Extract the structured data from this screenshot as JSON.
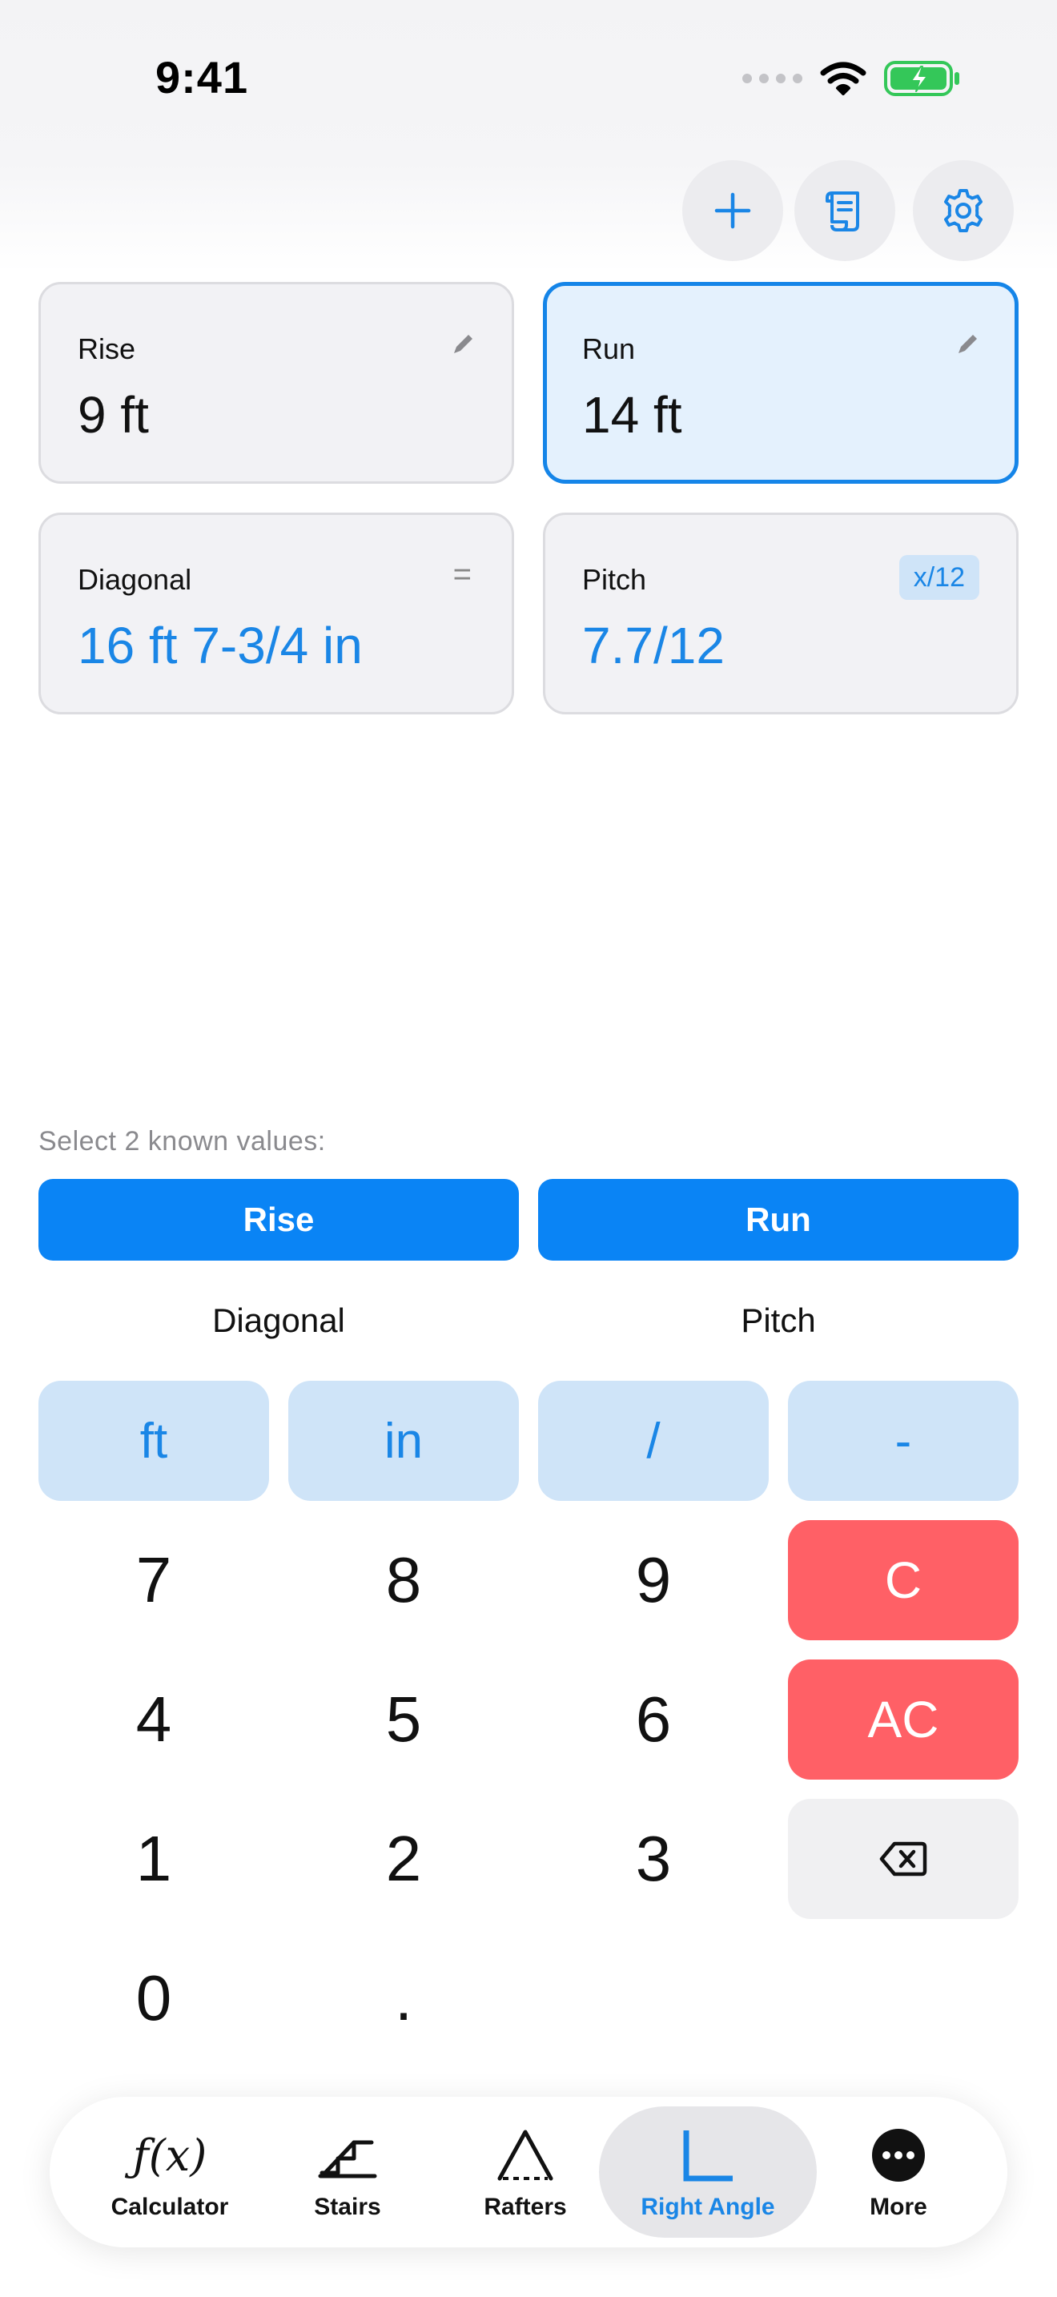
{
  "status_bar": {
    "time": "9:41"
  },
  "cards": {
    "rise": {
      "label": "Rise",
      "value": "9 ft"
    },
    "run": {
      "label": "Run",
      "value": "14 ft"
    },
    "diagonal": {
      "label": "Diagonal",
      "value": "16 ft 7-3/4 in",
      "indicator": "="
    },
    "pitch": {
      "label": "Pitch",
      "value": "7.7/12",
      "badge": "x/12"
    }
  },
  "selector": {
    "hint": "Select 2 known values:",
    "options": [
      {
        "label": "Rise",
        "selected": true
      },
      {
        "label": "Run",
        "selected": true
      },
      {
        "label": "Diagonal",
        "selected": false
      },
      {
        "label": "Pitch",
        "selected": false
      }
    ]
  },
  "keypad": {
    "units": [
      "ft",
      "in",
      "/",
      "-"
    ],
    "digits": [
      "7",
      "8",
      "9",
      "4",
      "5",
      "6",
      "1",
      "2",
      "3",
      "0",
      "."
    ],
    "clear": "C",
    "all_clear": "AC"
  },
  "tabbar": {
    "items": [
      {
        "label": "Calculator",
        "icon": "function-icon",
        "icon_text": "ƒ(x)"
      },
      {
        "label": "Stairs",
        "icon": "stairs-icon"
      },
      {
        "label": "Rafters",
        "icon": "rafters-icon"
      },
      {
        "label": "Right Angle",
        "icon": "right-angle-icon",
        "active": true
      },
      {
        "label": "More",
        "icon": "more-icon"
      }
    ]
  },
  "colors": {
    "accent": "#0a84f5",
    "accent_text": "#1a86e6",
    "unit_key_bg": "#cfe4f8",
    "clear_red": "#ff6066",
    "battery_green": "#34c759"
  }
}
